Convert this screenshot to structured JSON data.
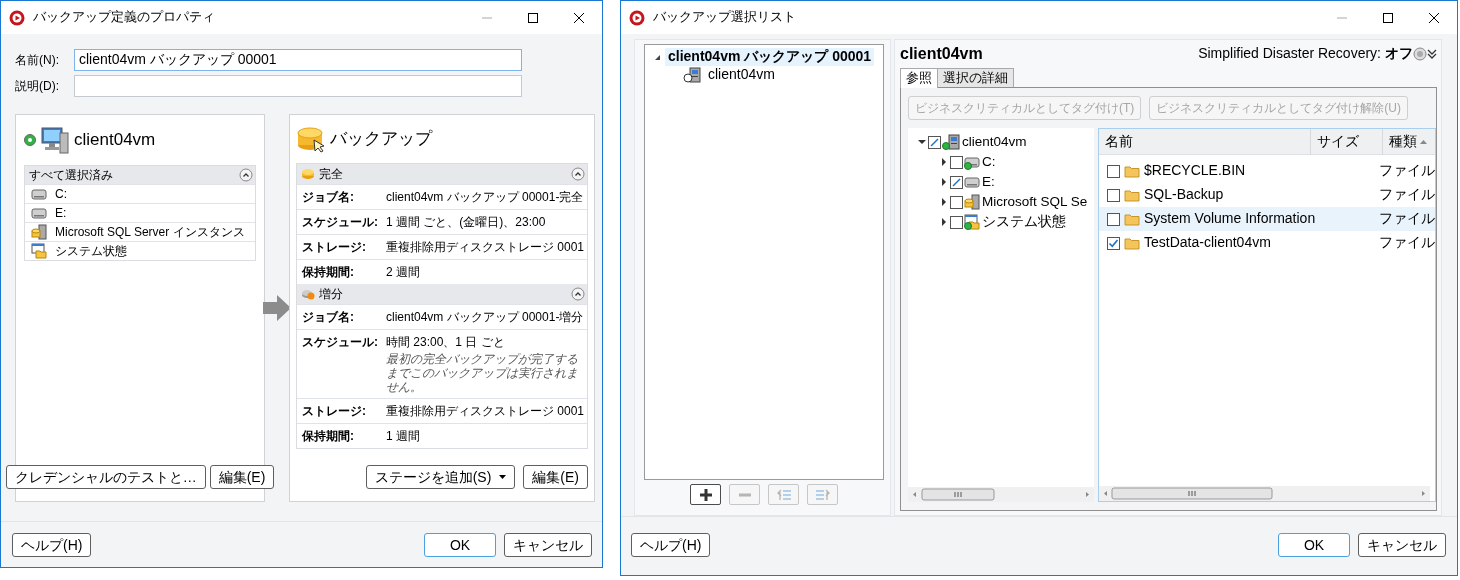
{
  "left_window": {
    "title": "バックアップ定義のプロパティ",
    "name_field": {
      "label": "名前(N):",
      "value": "client04vm バックアップ 00001"
    },
    "description_field": {
      "label": "説明(D):"
    },
    "source_panel": {
      "title": "client04vm",
      "online": true,
      "group": {
        "title": "すべて選択済み",
        "expanded": true,
        "items": [
          {
            "kind": "disk",
            "label": "C:"
          },
          {
            "kind": "disk",
            "label": "E:"
          },
          {
            "kind": "sql",
            "label": "Microsoft SQL Server インスタンス"
          },
          {
            "kind": "system",
            "label": "システム状態"
          }
        ]
      },
      "buttons": [
        "クレデンシャルのテストと…",
        "編集(E)"
      ]
    },
    "backup_panel": {
      "title": "バックアップ",
      "stages": [
        {
          "kind": "full",
          "title": "完全",
          "expanded": true,
          "fields": [
            {
              "label": "ジョブ名:",
              "value": "client04vm バックアップ 00001-完全"
            },
            {
              "label": "スケジュール:",
              "value": "1 週間 ごと、(金曜日)、23:00"
            },
            {
              "label": "ストレージ:",
              "value": "重複排除用ディスクストレージ 0001"
            },
            {
              "label": "保持期間:",
              "value": "2 週間"
            }
          ]
        },
        {
          "kind": "incremental",
          "title": "増分",
          "expanded": true,
          "fields": [
            {
              "label": "ジョブ名:",
              "value": "client04vm バックアップ 00001-増分"
            },
            {
              "label": "スケジュール:",
              "value": "時間 23:00、1 日 ごと",
              "note": "最初の完全バックアップが完了するまでこのバックアップは実行されません。"
            },
            {
              "label": "ストレージ:",
              "value": "重複排除用ディスクストレージ 0001"
            },
            {
              "label": "保持期間:",
              "value": "1 週間"
            }
          ]
        }
      ],
      "add_stage_button": "ステージを追加(S)",
      "edit_button": "編集(E)"
    },
    "footer": {
      "help": "ヘルプ(H)",
      "ok": "OK",
      "cancel": "キャンセル"
    }
  },
  "right_window": {
    "title": "バックアップ選択リスト",
    "selection_tree": [
      {
        "label": "client04vm バックアップ 00001",
        "selected": true,
        "expanded": true,
        "children": [
          {
            "label": "client04vm",
            "selected": false
          }
        ]
      }
    ],
    "list_tools": [
      {
        "kind": "add",
        "disabled": false
      },
      {
        "kind": "remove",
        "disabled": true
      },
      {
        "kind": "move-left",
        "disabled": true
      },
      {
        "kind": "move-right",
        "disabled": true
      }
    ],
    "detail": {
      "title": "client04vm",
      "sdr_label": "Simplified Disaster Recovery:",
      "sdr_value": "オフ",
      "tabs": [
        {
          "label": "参照",
          "selected": true
        },
        {
          "label": "選択の詳細",
          "selected": false
        }
      ],
      "tag_buttons": [
        {
          "label": "ビジネスクリティカルとしてタグ付け(T)",
          "disabled": true
        },
        {
          "label": "ビジネスクリティカルとしてタグ付け解除(U)",
          "disabled": true
        }
      ],
      "browse_tree": [
        {
          "label": "client04vm",
          "kind": "server",
          "online": true,
          "checked": false,
          "partial": true,
          "expanded": true,
          "children": [
            {
              "label": "C:",
              "kind": "disk",
              "online": true,
              "checked": false,
              "partial": false,
              "expanded": false
            },
            {
              "label": "E:",
              "kind": "disk",
              "online": false,
              "checked": false,
              "partial": true,
              "expanded": false
            },
            {
              "label": "Microsoft SQL Se",
              "kind": "sql",
              "online": false,
              "checked": false,
              "partial": false,
              "expanded": false
            },
            {
              "label": "システム状態",
              "kind": "system",
              "online": true,
              "checked": false,
              "partial": false,
              "expanded": false
            }
          ]
        }
      ],
      "files": {
        "columns": [
          "名前",
          "サイズ",
          "種類"
        ],
        "rows": [
          {
            "name": "$RECYCLE.BIN",
            "type": "ファイル",
            "checked": false,
            "selected": false
          },
          {
            "name": "SQL-Backup",
            "type": "ファイル",
            "checked": false,
            "selected": false
          },
          {
            "name": "System Volume Information",
            "type": "ファイル",
            "checked": false,
            "selected": true
          },
          {
            "name": "TestData-client04vm",
            "type": "ファイル",
            "checked": true,
            "selected": false
          }
        ]
      }
    },
    "footer": {
      "help": "ヘルプ(H)",
      "ok": "OK",
      "cancel": "キャンセル"
    }
  }
}
